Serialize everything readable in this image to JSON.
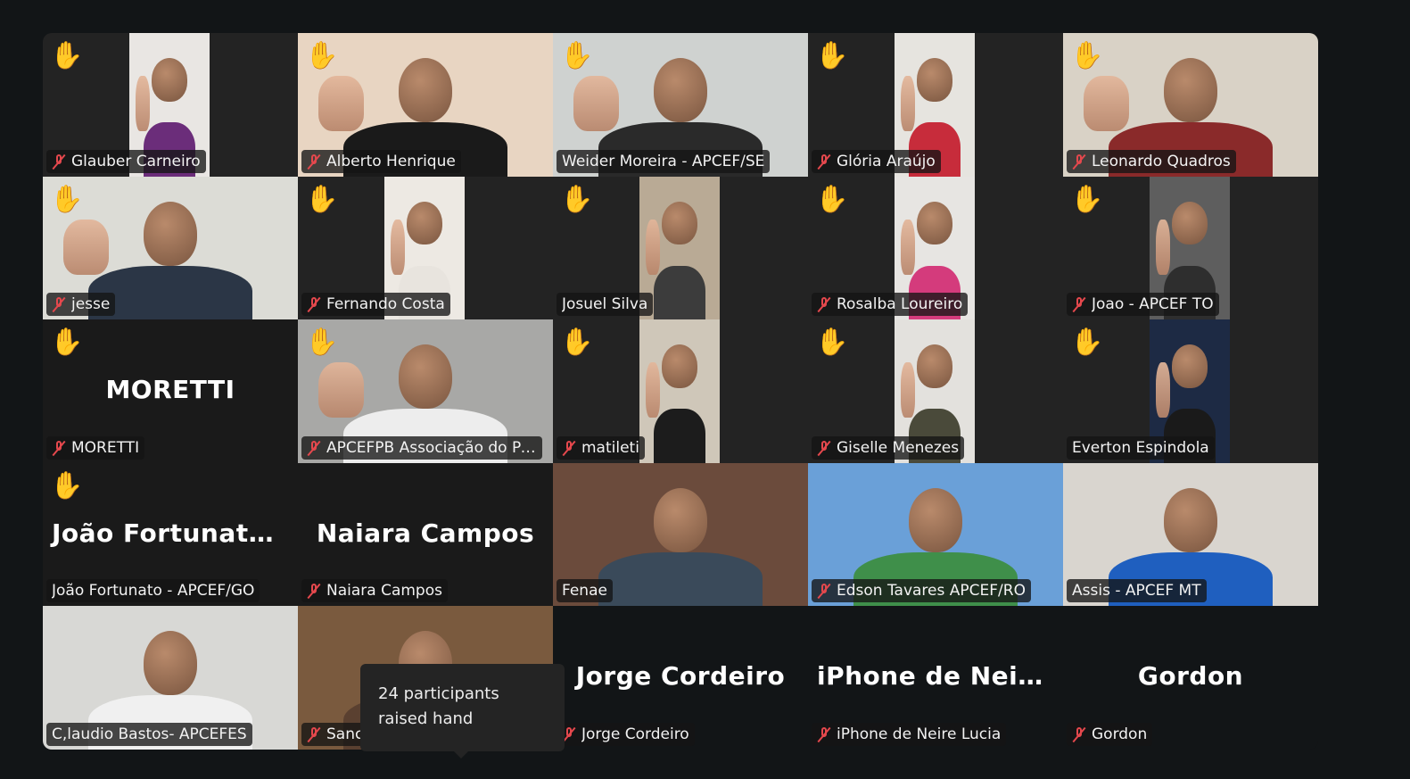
{
  "tooltip": {
    "text": "24 participants raised hand"
  },
  "colors": {
    "active_speaker": "#2bdc7a",
    "muted": "#e5484d",
    "raised_hand": "#f5c542",
    "tile_bg": "#1a1a1a"
  },
  "participants": [
    {
      "name": "Glauber Carneiro",
      "muted": true,
      "hand": true,
      "video": "mid",
      "bg": "#e9e6e3",
      "shirt": "#6b2d7a"
    },
    {
      "name": "Alberto Henrique",
      "muted": true,
      "hand": true,
      "video": "full",
      "bg": "#e8d5c2",
      "shirt": "#1a1a1a"
    },
    {
      "name": "Weider Moreira - APCEF/SE",
      "muted": false,
      "hand": true,
      "video": "full",
      "bg": "#cfd2d0",
      "shirt": "#2a2a2a"
    },
    {
      "name": "Glória Araújo",
      "muted": true,
      "hand": true,
      "video": "mid",
      "bg": "#e6e4df",
      "shirt": "#c72c3b"
    },
    {
      "name": "Leonardo Quadros",
      "muted": true,
      "hand": true,
      "video": "full",
      "bg": "#d9d2c6",
      "shirt": "#8a2a2a"
    },
    {
      "name": "jesse",
      "muted": true,
      "hand": true,
      "video": "full",
      "bg": "#dcdcd6",
      "shirt": "#2b3646"
    },
    {
      "name": "Fernando Costa",
      "muted": true,
      "hand": true,
      "video": "mid",
      "bg": "#ede9e3",
      "shirt": "#e8e4de"
    },
    {
      "name": "Josuel Silva",
      "muted": false,
      "hand": true,
      "video": "mid",
      "bg": "#b9aa95",
      "shirt": "#3c3c3c"
    },
    {
      "name": "Rosalba Loureiro",
      "muted": true,
      "hand": true,
      "video": "mid",
      "bg": "#e7e5e2",
      "shirt": "#d43b7c"
    },
    {
      "name": "Joao - APCEF TO",
      "muted": true,
      "hand": true,
      "video": "mid",
      "bg": "#5e5e5e",
      "shirt": "#2e2e2e"
    },
    {
      "name": "MORETTI",
      "muted": true,
      "hand": true,
      "video": "none",
      "big": "MORETTI"
    },
    {
      "name": "APCEFPB Associação do Pes...",
      "muted": true,
      "hand": true,
      "video": "full",
      "bg": "#a8a8a6",
      "shirt": "#ededed"
    },
    {
      "name": "matileti",
      "muted": true,
      "hand": true,
      "video": "mid",
      "bg": "#cfc7b9",
      "shirt": "#1c1c1c"
    },
    {
      "name": "Giselle Menezes",
      "muted": true,
      "hand": true,
      "video": "mid",
      "bg": "#e3e1dd",
      "shirt": "#4a4a3a"
    },
    {
      "name": "Everton Espindola",
      "muted": false,
      "hand": true,
      "video": "mid",
      "bg": "#1d2a44",
      "shirt": "#1a1a1a"
    },
    {
      "name": "João Fortunato - APCEF/GO",
      "muted": false,
      "hand": true,
      "video": "none",
      "big": "João  Fortunato..."
    },
    {
      "name": "Naiara Campos",
      "muted": true,
      "hand": false,
      "video": "none",
      "big": "Naiara Campos"
    },
    {
      "name": "Fenae",
      "muted": false,
      "hand": false,
      "video": "full",
      "bg": "#6b4b3c",
      "shirt": "#3a4a5a",
      "talking": true
    },
    {
      "name": "Edson Tavares APCEF/RO",
      "muted": true,
      "hand": false,
      "video": "full",
      "bg": "#6aa0d8",
      "shirt": "#3f8f4a"
    },
    {
      "name": "Assis - APCEF MT",
      "muted": false,
      "hand": false,
      "video": "full",
      "bg": "#d9d5cf",
      "shirt": "#1f5fbf"
    },
    {
      "name": "C,laudio Bastos- APCEFES",
      "muted": false,
      "hand": false,
      "video": "full",
      "bg": "#d8d8d5",
      "shirt": "#f0f0f0"
    },
    {
      "name": "Sanc",
      "muted": true,
      "hand": false,
      "video": "full",
      "bg": "#7a5a3e",
      "shirt": "#5a4030"
    },
    {
      "name": "Jorge Cordeiro",
      "muted": true,
      "hand": false,
      "video": "none",
      "big": "Jorge Cordeiro",
      "empty": true
    },
    {
      "name": "iPhone de Neire Lucia",
      "muted": true,
      "hand": false,
      "video": "none",
      "big": "iPhone  de  Neire...",
      "empty": true
    },
    {
      "name": "Gordon",
      "muted": true,
      "hand": false,
      "video": "none",
      "big": "Gordon",
      "empty": true
    }
  ]
}
